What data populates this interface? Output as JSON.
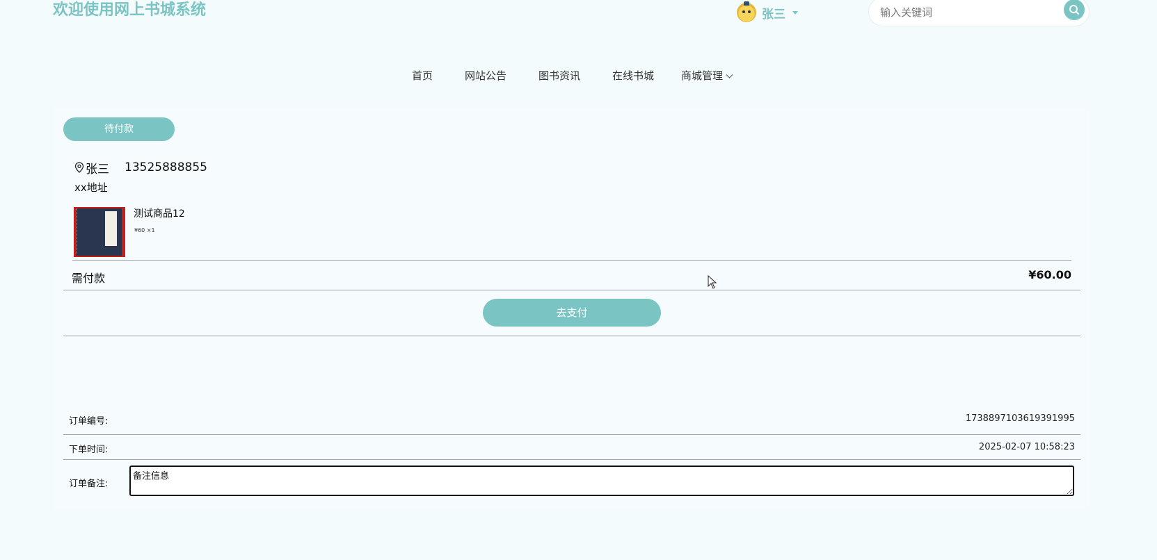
{
  "header": {
    "site_title": "欢迎使用网上书城系统",
    "username": "张三",
    "search_placeholder": "输入关键词"
  },
  "nav": {
    "items": [
      {
        "label": "首页"
      },
      {
        "label": "网站公告"
      },
      {
        "label": "图书资讯"
      },
      {
        "label": "在线书城"
      },
      {
        "label": "商城管理"
      }
    ]
  },
  "order": {
    "status": "待付款",
    "receiver": {
      "name": "张三",
      "phone": "13525888855",
      "address": "xx地址"
    },
    "goods": [
      {
        "name": "测试商品12",
        "meta": "¥60 ×1"
      }
    ],
    "need_pay_label": "需付款",
    "need_pay_amount": "¥60.00",
    "pay_button": "去支付",
    "order_no_label": "订单编号:",
    "order_no": "1738897103619391995",
    "order_time_label": "下单时间:",
    "order_time": "2025-02-07 10:58:23",
    "remark_label": "订单备注:",
    "remark_value": "备注信息"
  },
  "colors": {
    "accent": "#7bc4c4",
    "background": "#f4fbfd"
  }
}
